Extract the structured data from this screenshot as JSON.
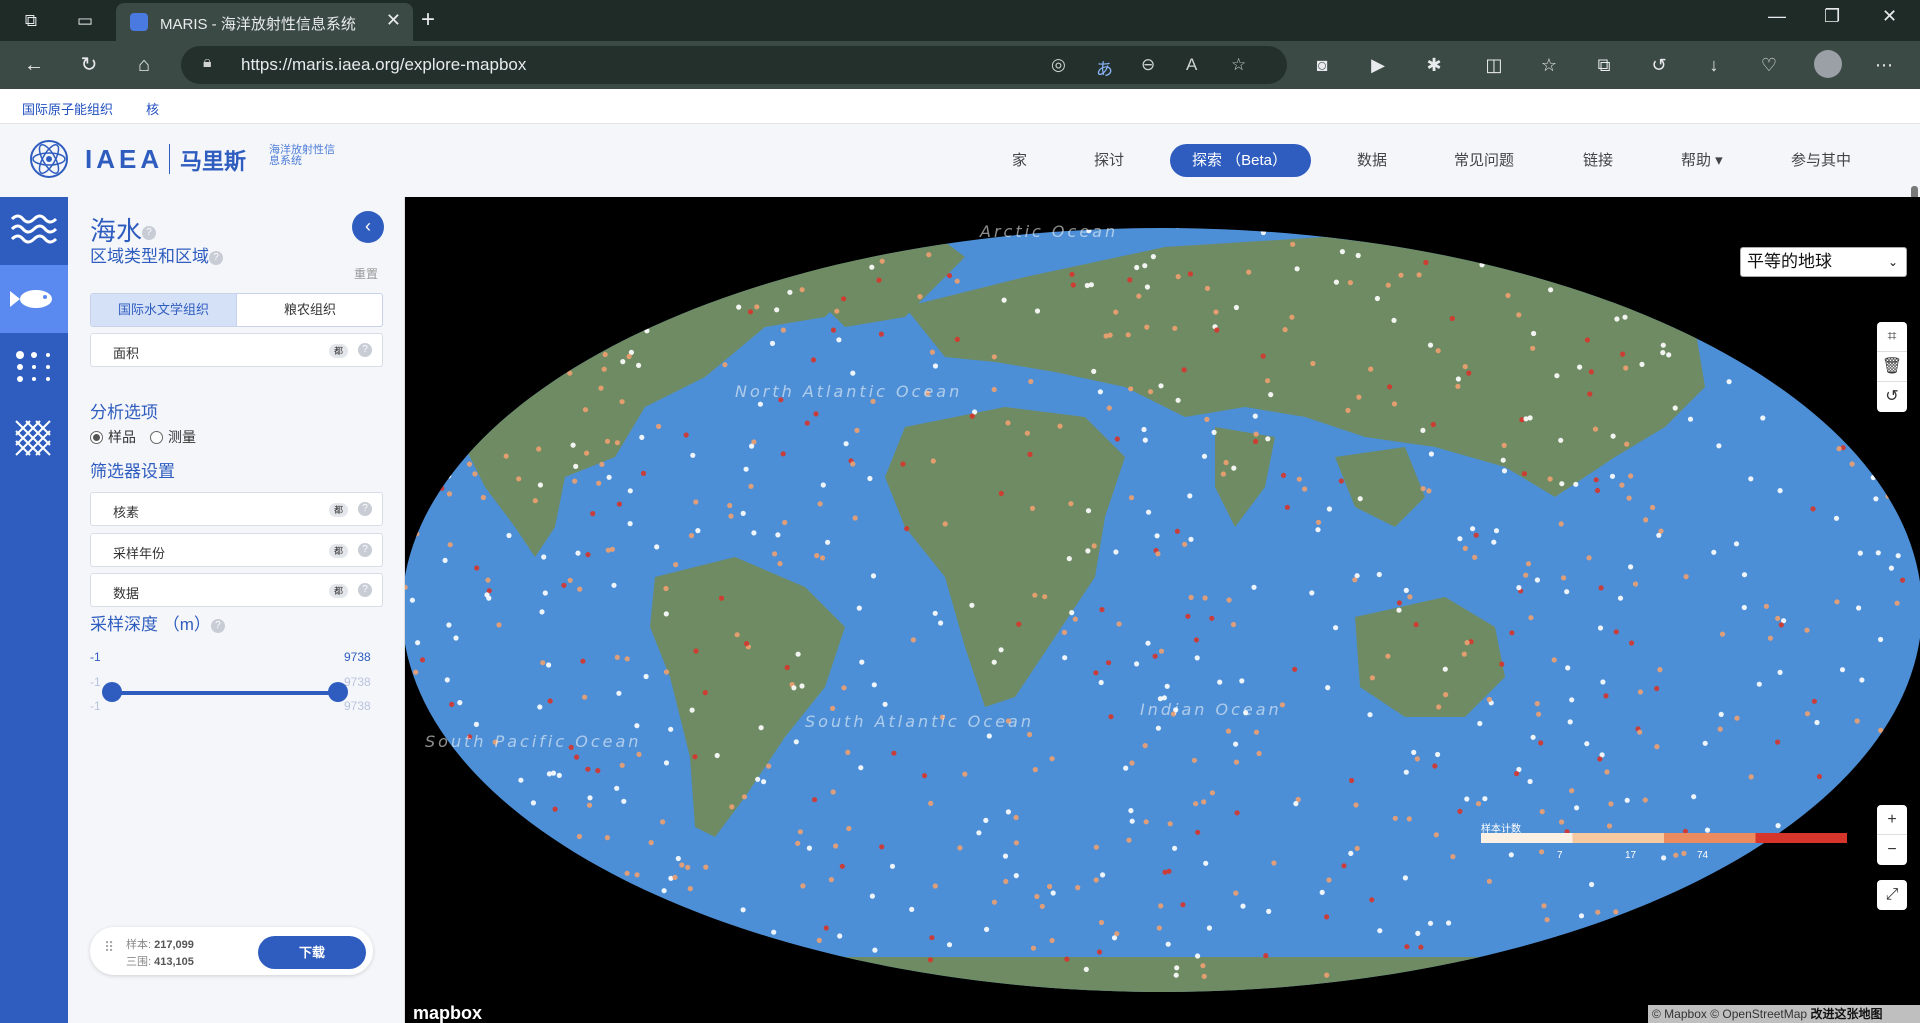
{
  "browser": {
    "tab_title": "MARIS - 海洋放射性信息系统",
    "url": "https://maris.iaea.org/explore-mapbox"
  },
  "site_links": [
    "国际原子能组织",
    "核"
  ],
  "header": {
    "logo_text": "IAEA",
    "logo_cn": "马里斯",
    "logo_sub": "海洋放射性信息系统",
    "nav": [
      {
        "label": "家"
      },
      {
        "label": "探讨"
      },
      {
        "label": "探索 （Beta）",
        "active": true
      },
      {
        "label": "数据"
      },
      {
        "label": "常见问题"
      },
      {
        "label": "链接"
      },
      {
        "label": "帮助 ▾"
      },
      {
        "label": "参与其中"
      }
    ]
  },
  "rail": {
    "items": [
      {
        "icon": "waves-icon"
      },
      {
        "icon": "fish-icon",
        "active": true
      },
      {
        "icon": "dots-grid-icon"
      },
      {
        "icon": "mesh-icon"
      }
    ]
  },
  "panel": {
    "title": "海水",
    "region_section": "区域类型和区域",
    "reset": "重置",
    "segment": {
      "on": "国际水文学组织",
      "off": "粮农组织"
    },
    "area_field": {
      "label": "面积",
      "tag": "都"
    },
    "analysis_section": "分析选项",
    "radios": [
      {
        "label": "样品",
        "selected": true
      },
      {
        "label": "测量",
        "selected": false
      }
    ],
    "filter_section": "筛选器设置",
    "filters": [
      {
        "label": "核素",
        "tag": "都"
      },
      {
        "label": "采样年份",
        "tag": "都"
      },
      {
        "label": "数据",
        "tag": "都"
      }
    ],
    "depth_section": "采样深度 （m）",
    "depth": {
      "min": "-1",
      "max": "9738"
    },
    "footer": {
      "samples_label": "样本:",
      "samples_value": "217,099",
      "measure_label": "三围:",
      "measure_value": "413,105",
      "download": "下载"
    }
  },
  "map": {
    "projection": "平等的地球",
    "ocean_labels": [
      "Arctic Ocean",
      "North Atlantic Ocean",
      "South Atlantic Ocean",
      "Indian Ocean",
      "South Pacific Ocean"
    ],
    "legend": {
      "title": "样本计数",
      "ticks": [
        "7",
        "17",
        "74"
      ],
      "colors": [
        "#fbf0e4",
        "#f7c9a0",
        "#ec8b60",
        "#d6352b"
      ]
    },
    "attribution": {
      "mapbox": "© Mapbox",
      "osm": "© OpenStreetMap",
      "improve": "改进这张地图"
    },
    "mapbox_logo": "mapbox",
    "colors": {
      "ocean": "#4d8fd6",
      "land": "#6f8b63",
      "point_low": "#ffffff",
      "point_mid": "#f0a070",
      "point_high": "#d6352b"
    }
  }
}
